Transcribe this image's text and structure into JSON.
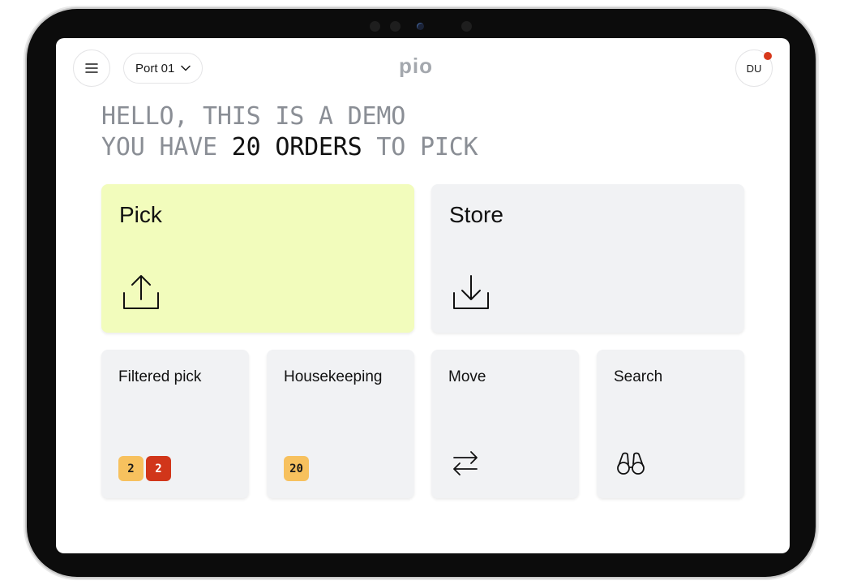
{
  "header": {
    "menu_icon": "hamburger-menu-icon",
    "port_select": {
      "value": "Port 01",
      "icon": "chevron-down-icon"
    },
    "logo": {
      "text": "pio"
    },
    "user": {
      "initials": "DU",
      "has_notification": true,
      "notification_color": "#d7381b"
    }
  },
  "greeting": {
    "line1": "HELLO, THIS IS A DEMO",
    "line2_prefix": "YOU HAVE ",
    "line2_highlight": "20 ORDERS",
    "line2_suffix": " TO PICK"
  },
  "tiles": {
    "pick": {
      "label": "Pick",
      "icon": "upload-icon",
      "background": "#f2fcbc"
    },
    "store": {
      "label": "Store",
      "icon": "download-icon",
      "background": "#f1f2f4"
    },
    "filtered_pick": {
      "label": "Filtered pick",
      "badges": [
        {
          "value": "2",
          "color": "#f7c15e",
          "text_color": "#1a1a1a"
        },
        {
          "value": "2",
          "color": "#d1361a",
          "text_color": "#ffffff"
        }
      ]
    },
    "housekeeping": {
      "label": "Housekeeping",
      "badges": [
        {
          "value": "20",
          "color": "#f7c15e",
          "text_color": "#1a1a1a"
        }
      ]
    },
    "move": {
      "label": "Move",
      "icon": "arrows-swap-icon"
    },
    "search": {
      "label": "Search",
      "icon": "binoculars-icon"
    }
  }
}
